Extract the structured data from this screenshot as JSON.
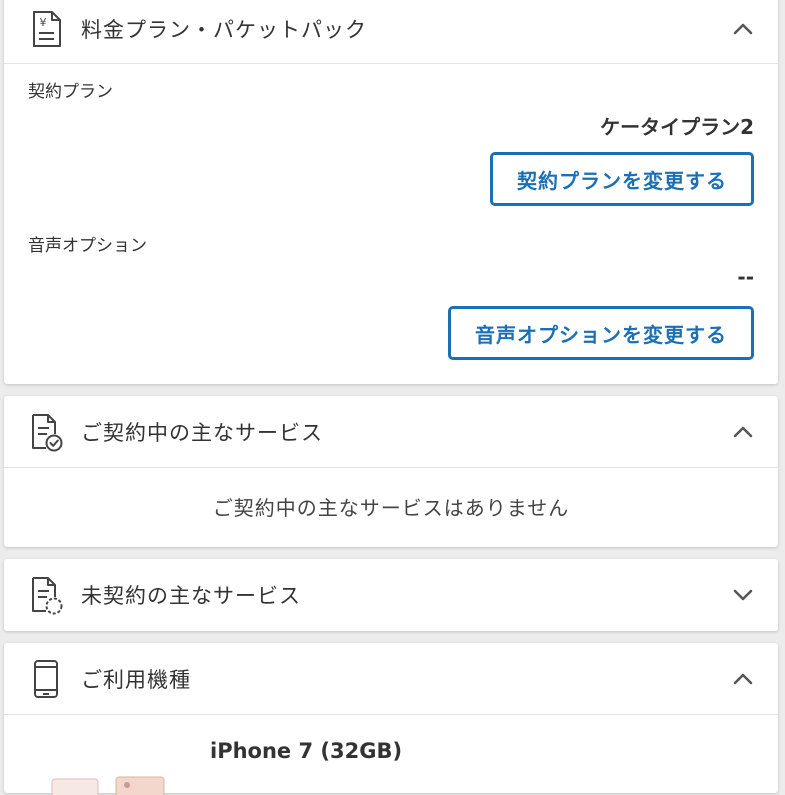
{
  "plan_section": {
    "title": "料金プラン・パケットパック",
    "icon": "yen-document-icon",
    "contract_plan_label": "契約プラン",
    "contract_plan_value": "ケータイプラン2",
    "change_plan_button": "契約プランを変更する",
    "voice_option_label": "音声オプション",
    "voice_option_value": "--",
    "change_voice_button": "音声オプションを変更する",
    "expanded": true
  },
  "subscribed_services": {
    "title": "ご契約中の主なサービス",
    "icon": "document-check-icon",
    "empty_message": "ご契約中の主なサービスはありません",
    "expanded": true
  },
  "unsubscribed_services": {
    "title": "未契約の主なサービス",
    "icon": "document-dashed-icon",
    "expanded": false
  },
  "device_section": {
    "title": "ご利用機種",
    "icon": "smartphone-icon",
    "device_name": "iPhone 7 (32GB)",
    "expanded": true
  },
  "colors": {
    "accent": "#1b6fb5",
    "background": "#ececec",
    "card": "#ffffff",
    "text": "#333333"
  }
}
